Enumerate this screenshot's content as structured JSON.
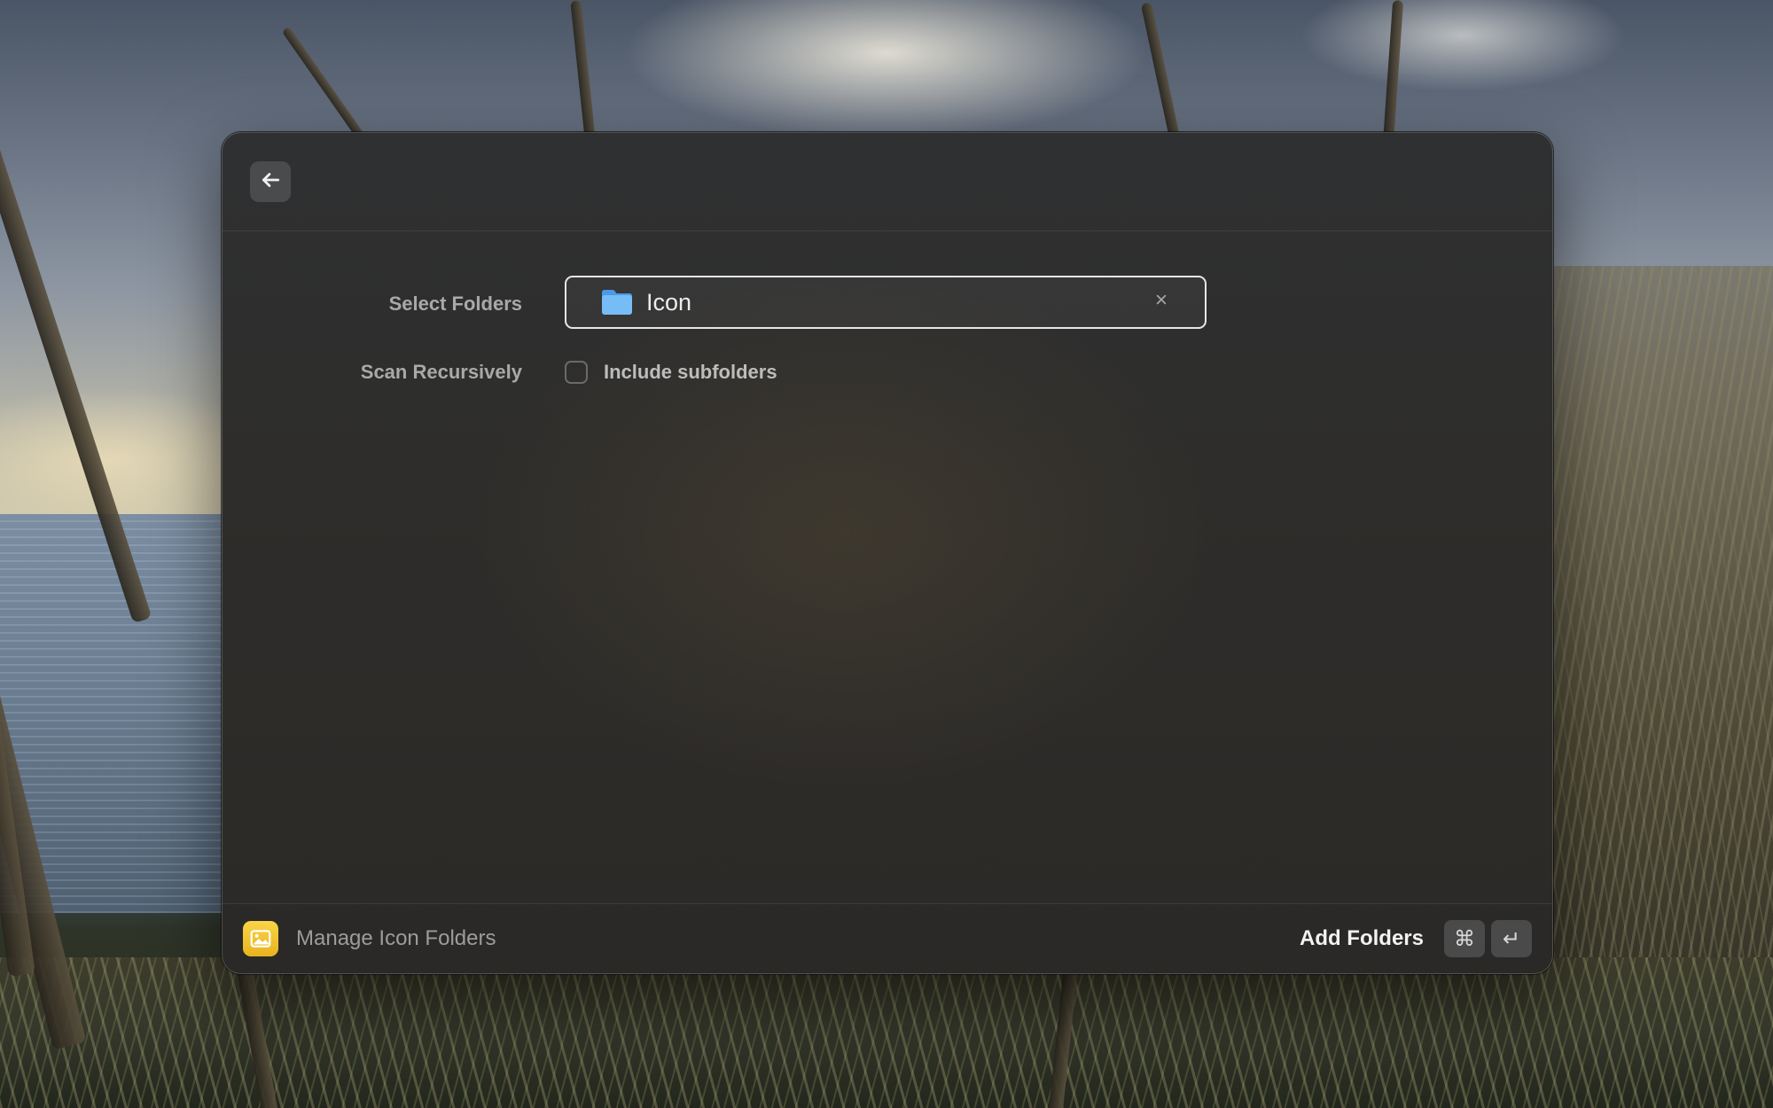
{
  "window": {
    "back_icon": "arrow-left-icon"
  },
  "form": {
    "select_folders_label": "Select Folders",
    "selected_folder": {
      "icon": "folder-icon",
      "name": "Icon",
      "clear_icon": "close-icon"
    },
    "scan_recursively_label": "Scan Recursively",
    "include_subfolders_label": "Include subfolders",
    "include_subfolders_checked": false
  },
  "footer": {
    "app_icon": "image-icon",
    "title": "Manage Icon Folders",
    "action_label": "Add Folders",
    "shortcut_keys": [
      "⌘",
      "↵"
    ]
  },
  "colors": {
    "accent_app_icon": "#f3c634",
    "folder_icon": "#6cb6f5",
    "field_border": "#e6e6e6"
  }
}
